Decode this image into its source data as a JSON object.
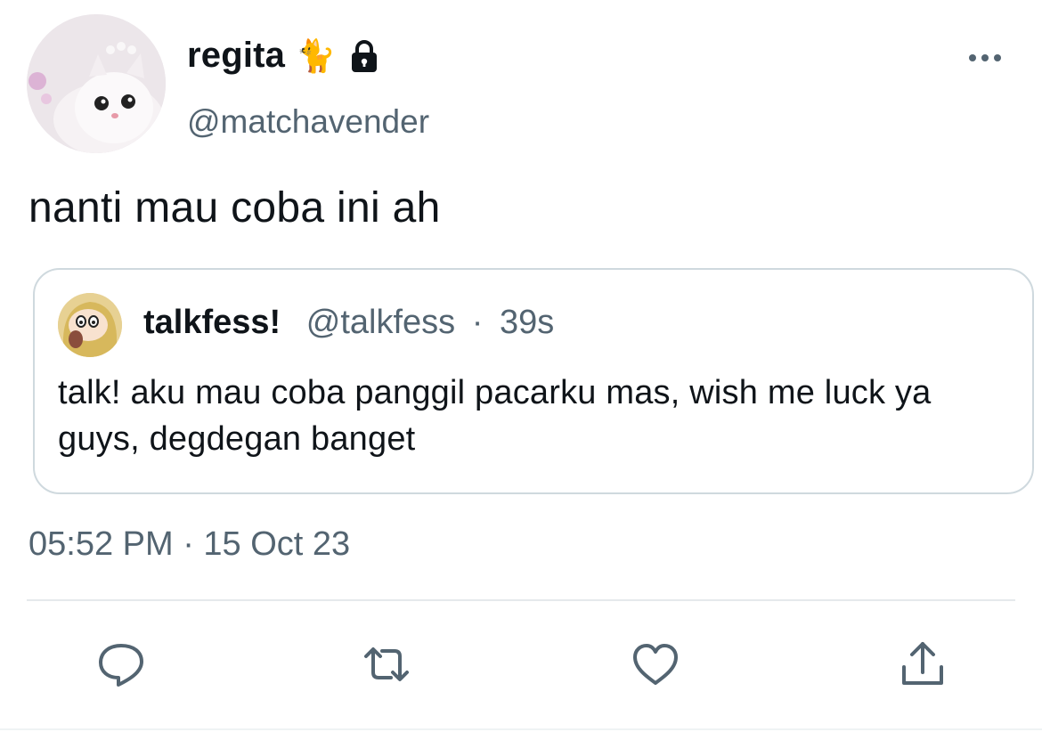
{
  "author": {
    "display_name": "regita",
    "emoji": "🐈",
    "handle": "@matchavender"
  },
  "tweet": {
    "text": "nanti mau coba ini ah",
    "timestamp": "05:52 PM · 15 Oct 23"
  },
  "quoted": {
    "display_name": "talkfess!",
    "handle": "@talkfess",
    "separator": "·",
    "time": "39s",
    "text": "talk! aku mau coba panggil pacarku mas, wish me luck ya guys, degdegan banget"
  },
  "icons": {
    "lock": "lock-icon",
    "more": "more-icon",
    "reply": "reply-icon",
    "retweet": "retweet-icon",
    "like": "like-icon",
    "share": "share-icon"
  },
  "colors": {
    "text_primary": "#0f1419",
    "text_secondary": "#536471",
    "border": "#cfd9de"
  }
}
